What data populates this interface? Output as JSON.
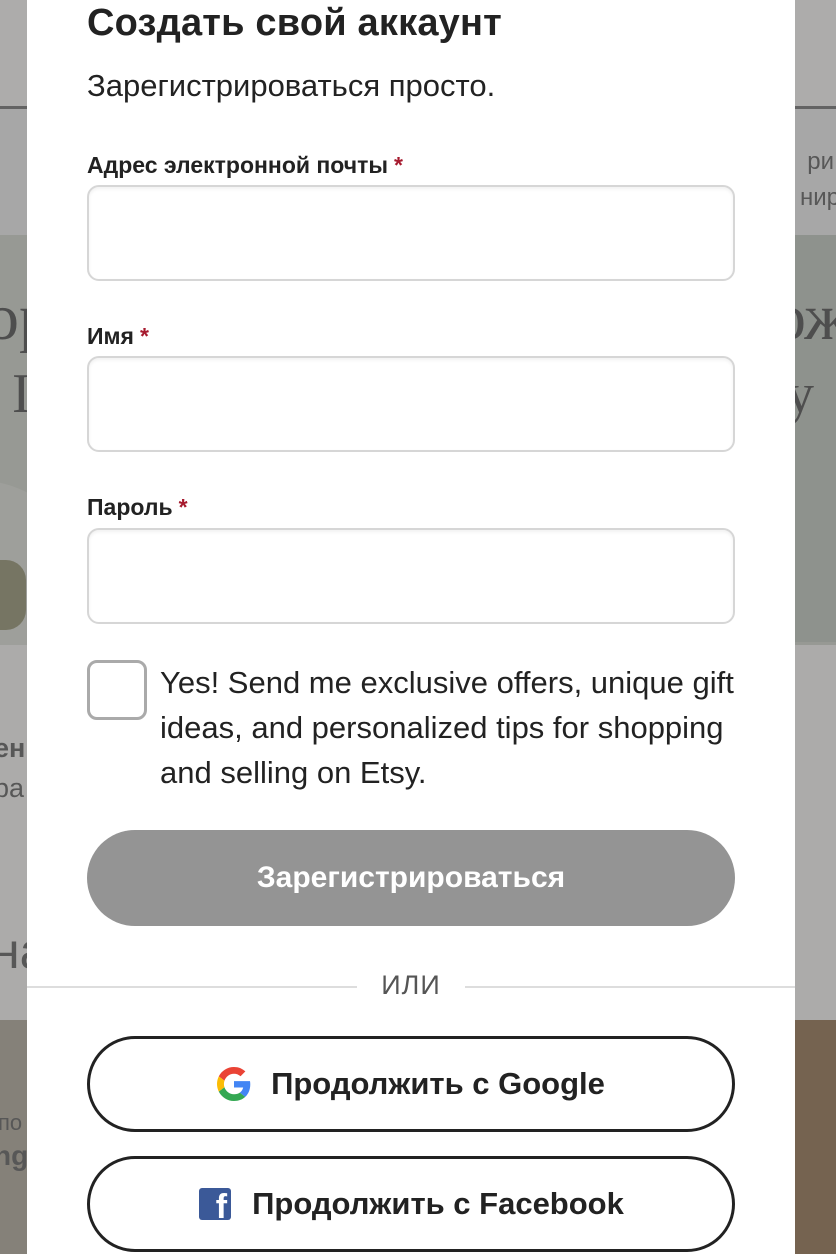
{
  "background": {
    "fragments": [
      "ри",
      "нир",
      "ор",
      "ож",
      "I",
      "y",
      "ен",
      "ра",
      "на",
      "по",
      "ng"
    ]
  },
  "modal": {
    "title": "Создать свой аккаунт",
    "subtitle": "Зарегистрироваться просто.",
    "required_mark": "*",
    "fields": {
      "email": {
        "label": "Адрес электронной почты",
        "value": "",
        "placeholder": ""
      },
      "name": {
        "label": "Имя",
        "value": "",
        "placeholder": ""
      },
      "password": {
        "label": "Пароль",
        "value": "",
        "placeholder": ""
      }
    },
    "newsletter": {
      "checked": false,
      "text": "Yes! Send me exclusive offers, unique gift ideas, and personalized tips for shopping and selling on Etsy."
    },
    "register_button": "Зарегистрироваться",
    "divider": "ИЛИ",
    "google_button": "Продолжить с Google",
    "facebook_button": "Продолжить с Facebook"
  },
  "colors": {
    "required": "#a61a2e",
    "register_button_disabled": "#949494",
    "facebook_brand": "#3b5998"
  }
}
